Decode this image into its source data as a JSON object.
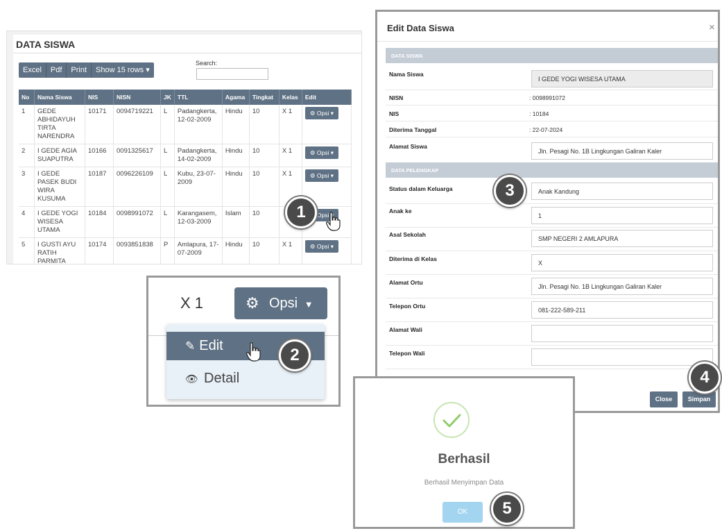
{
  "list_panel": {
    "title": "DATA SISWA",
    "toolbar": [
      "Excel",
      "Pdf",
      "Print",
      "Show 15 rows ▾"
    ],
    "search_label": "Search:",
    "columns": [
      "No",
      "Nama Siswa",
      "NIS",
      "NISN",
      "JK",
      "TTL",
      "Agama",
      "Tingkat",
      "Kelas",
      "Edit"
    ],
    "opsi_label": "Opsi ▾",
    "rows": [
      {
        "no": "1",
        "nama": "GEDE ABHIDAYUH TIRTA NARENDRA",
        "nis": "10171",
        "nisn": "0094719221",
        "jk": "L",
        "ttl": "Padangkerta, 12-02-2009",
        "agama": "Hindu",
        "tingkat": "10",
        "kelas": "X 1"
      },
      {
        "no": "2",
        "nama": "I GEDE AGIA SUAPUTRA",
        "nis": "10166",
        "nisn": "0091325617",
        "jk": "L",
        "ttl": "Padangkerta, 14-02-2009",
        "agama": "Hindu",
        "tingkat": "10",
        "kelas": "X 1"
      },
      {
        "no": "3",
        "nama": "I GEDE PASEK BUDI WIRA KUSUMA",
        "nis": "10187",
        "nisn": "0096226109",
        "jk": "L",
        "ttl": "Kubu, 23-07-2009",
        "agama": "Hindu",
        "tingkat": "10",
        "kelas": "X 1"
      },
      {
        "no": "4",
        "nama": "I GEDE YOGI WISESA UTAMA",
        "nis": "10184",
        "nisn": "0098991072",
        "jk": "L",
        "ttl": "Karangasem, 12-03-2009",
        "agama": "Islam",
        "tingkat": "10",
        "kelas": ""
      },
      {
        "no": "5",
        "nama": "I GUSTI AYU RATIH PARMITA BERLIANTI",
        "nis": "10174",
        "nisn": "0093851838",
        "jk": "P",
        "ttl": "Amlapura, 17-07-2009",
        "agama": "Hindu",
        "tingkat": "10",
        "kelas": "X 1"
      }
    ]
  },
  "zoom": {
    "kelas": "X 1",
    "opsi": "Opsi",
    "menu_edit": "Edit",
    "menu_detail": "Detail"
  },
  "modal": {
    "title": "Edit Data Siswa",
    "close_glyph": "×",
    "section1": "DATA SISWA",
    "section2": "DATA PELENGKAP",
    "fields": {
      "nama_label": "Nama Siswa",
      "nama_value": "I GEDE YOGI WISESA UTAMA",
      "nisn_label": "NISN",
      "nisn_value": ": 0098991072",
      "nis_label": "NIS",
      "nis_value": ": 10184",
      "diterima_label": "Diterima Tanggal",
      "diterima_value": ": 22-07-2024",
      "alamat_label": "Alamat Siswa",
      "alamat_value": "Jln. Pesagi No. 1B Lingkungan Galiran Kaler",
      "status_label": "Status dalam Keluarga",
      "status_value": "Anak Kandung",
      "anak_label": "Anak ke",
      "anak_value": "1",
      "asal_label": "Asal Sekolah",
      "asal_value": "SMP NEGERI 2 AMLAPURA",
      "kelas_label": "Diterima di Kelas",
      "kelas_value": "X",
      "alamat_ortu_label": "Alamat Ortu",
      "alamat_ortu_value": "Jln. Pesagi No. 1B Lingkungan Galiran Kaler",
      "telp_ortu_label": "Telepon Ortu",
      "telp_ortu_value": "081-222-589-211",
      "alamat_wali_label": "Alamat Wali",
      "alamat_wali_value": "",
      "telp_wali_label": "Telepon Wali",
      "telp_wali_value": ""
    },
    "close_button": "Close",
    "save_button": "Simpan"
  },
  "success": {
    "title": "Berhasil",
    "message": "Berhasil Menyimpan Data",
    "ok": "OK"
  },
  "badges": [
    "1",
    "2",
    "3",
    "4",
    "5"
  ],
  "colors": {
    "primary": "#5f7184",
    "section": "#c4ccd6",
    "ok": "#a3d4f0",
    "check": "#8fcc6a",
    "badge": "#4a4a4a"
  }
}
